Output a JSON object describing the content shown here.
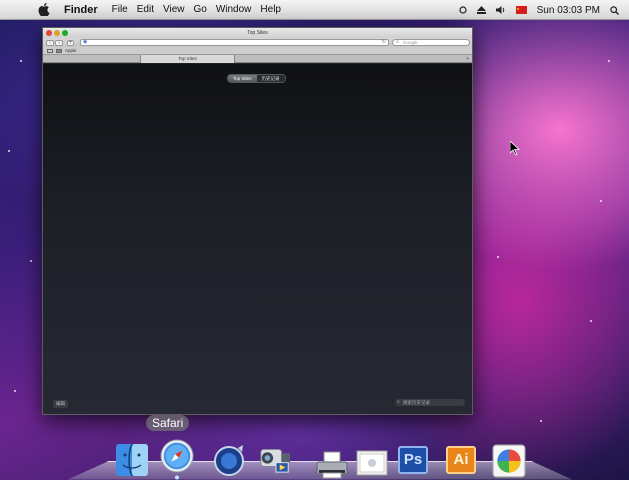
{
  "menubar": {
    "app_name": "Finder",
    "items": [
      "File",
      "Edit",
      "View",
      "Go",
      "Window",
      "Help"
    ],
    "clock": "Sun 03:03 PM",
    "status_icons": [
      "sync-icon",
      "eject-icon",
      "volume-icon",
      "flag-icon",
      "spotlight-icon"
    ]
  },
  "safari": {
    "window_title": "Top Sites",
    "address_value": "",
    "search_placeholder": "Google",
    "bookmark_label": "Apple",
    "tab_label": "Top Sites",
    "segments": [
      "Top Sites",
      "历史记录"
    ],
    "active_segment": 0,
    "edit_label": "编辑",
    "history_search_placeholder": "搜索历史记录"
  },
  "dock": {
    "tooltip": "Safari",
    "items": [
      {
        "name": "Finder",
        "icon": "finder-icon"
      },
      {
        "name": "Safari",
        "icon": "safari-icon"
      },
      {
        "name": "QuickTime",
        "icon": "quicktime-icon"
      },
      {
        "name": "iMovie",
        "icon": "imovie-icon"
      },
      {
        "name": "Printer",
        "icon": "printer-icon"
      },
      {
        "name": "Preview",
        "icon": "preview-icon"
      },
      {
        "name": "Photoshop",
        "icon": "photoshop-icon",
        "label": "Ps"
      },
      {
        "name": "Illustrator",
        "icon": "illustrator-icon",
        "label": "Ai"
      },
      {
        "name": "Photo Booth",
        "icon": "photos-icon"
      }
    ]
  },
  "colors": {
    "photoshop": "#1e4fa8",
    "illustrator": "#e8861b",
    "flag": "#d41c1c"
  }
}
